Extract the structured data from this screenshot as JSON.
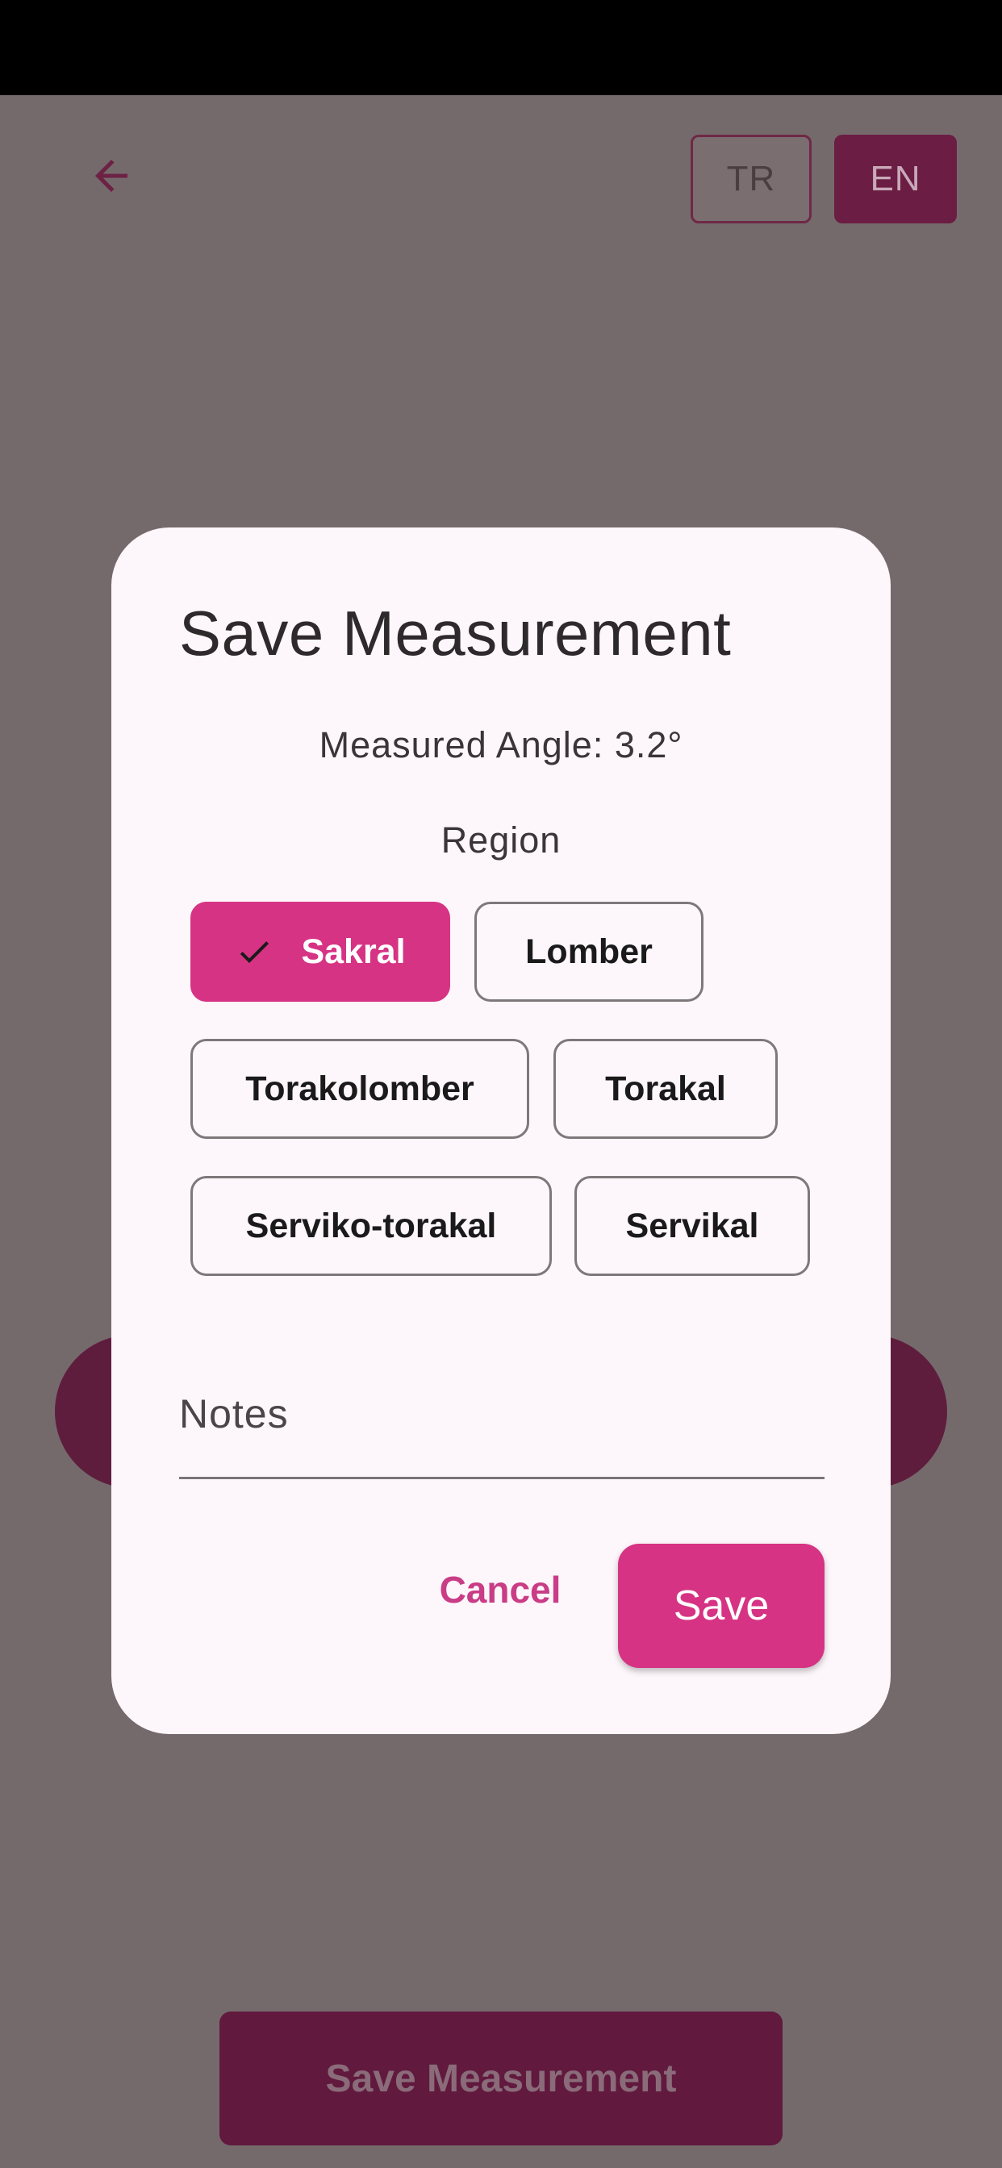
{
  "header": {
    "back_icon": "arrow-left-icon",
    "languages": [
      {
        "code": "TR",
        "selected": false
      },
      {
        "code": "EN",
        "selected": true
      }
    ]
  },
  "background": {
    "save_measurement_label": "Save Measurement"
  },
  "dialog": {
    "title": "Save Measurement",
    "measured_angle": "Measured Angle: 3.2°",
    "region_label": "Region",
    "regions": [
      {
        "label": "Sakral",
        "selected": true
      },
      {
        "label": "Lomber",
        "selected": false
      },
      {
        "label": "Torakolomber",
        "selected": false
      },
      {
        "label": "Torakal",
        "selected": false
      },
      {
        "label": "Serviko-torakal",
        "selected": false
      },
      {
        "label": "Servikal",
        "selected": false
      }
    ],
    "notes_label": "Notes",
    "notes_value": "",
    "cancel_label": "Cancel",
    "save_label": "Save"
  },
  "colors": {
    "accent": "#d63384",
    "scrim_background": "#756a6b",
    "dialog_surface": "#fdf6fa"
  }
}
